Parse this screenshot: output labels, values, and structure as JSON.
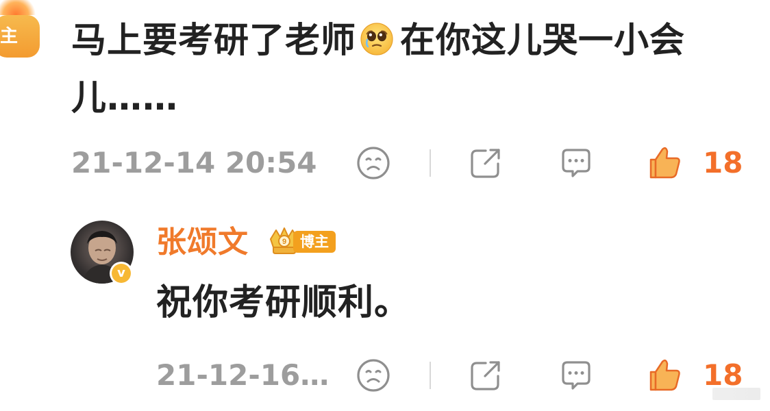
{
  "left_badge": {
    "label": "主"
  },
  "comment": {
    "text_part1": "马上要考研了老师",
    "text_part2": "在你这儿哭一小会儿……",
    "emoji_icon": "pleading-face-icon"
  },
  "comment_meta": {
    "timestamp": "21-12-14 20:54",
    "like_count": "18",
    "icons": [
      "sad-face-icon",
      "share-icon",
      "comment-icon",
      "thumbs-up-icon"
    ]
  },
  "reply": {
    "author": "张颂文",
    "badge_label": "博主",
    "verify_mark": "v",
    "text": "祝你考研顺利。",
    "avatar_icon": "avatar",
    "crown_icon": "crown-icon"
  },
  "reply_meta": {
    "timestamp": "21-12-16…",
    "like_count": "18",
    "icons": [
      "sad-face-icon",
      "share-icon",
      "comment-icon",
      "thumbs-up-icon"
    ]
  },
  "colors": {
    "text_primary": "#222222",
    "text_meta": "#9d9d9d",
    "accent_orange": "#f07a2b",
    "like_orange": "#f36f2a",
    "badge_yellow": "#f3a01e",
    "verify_yellow": "#f7b835"
  }
}
